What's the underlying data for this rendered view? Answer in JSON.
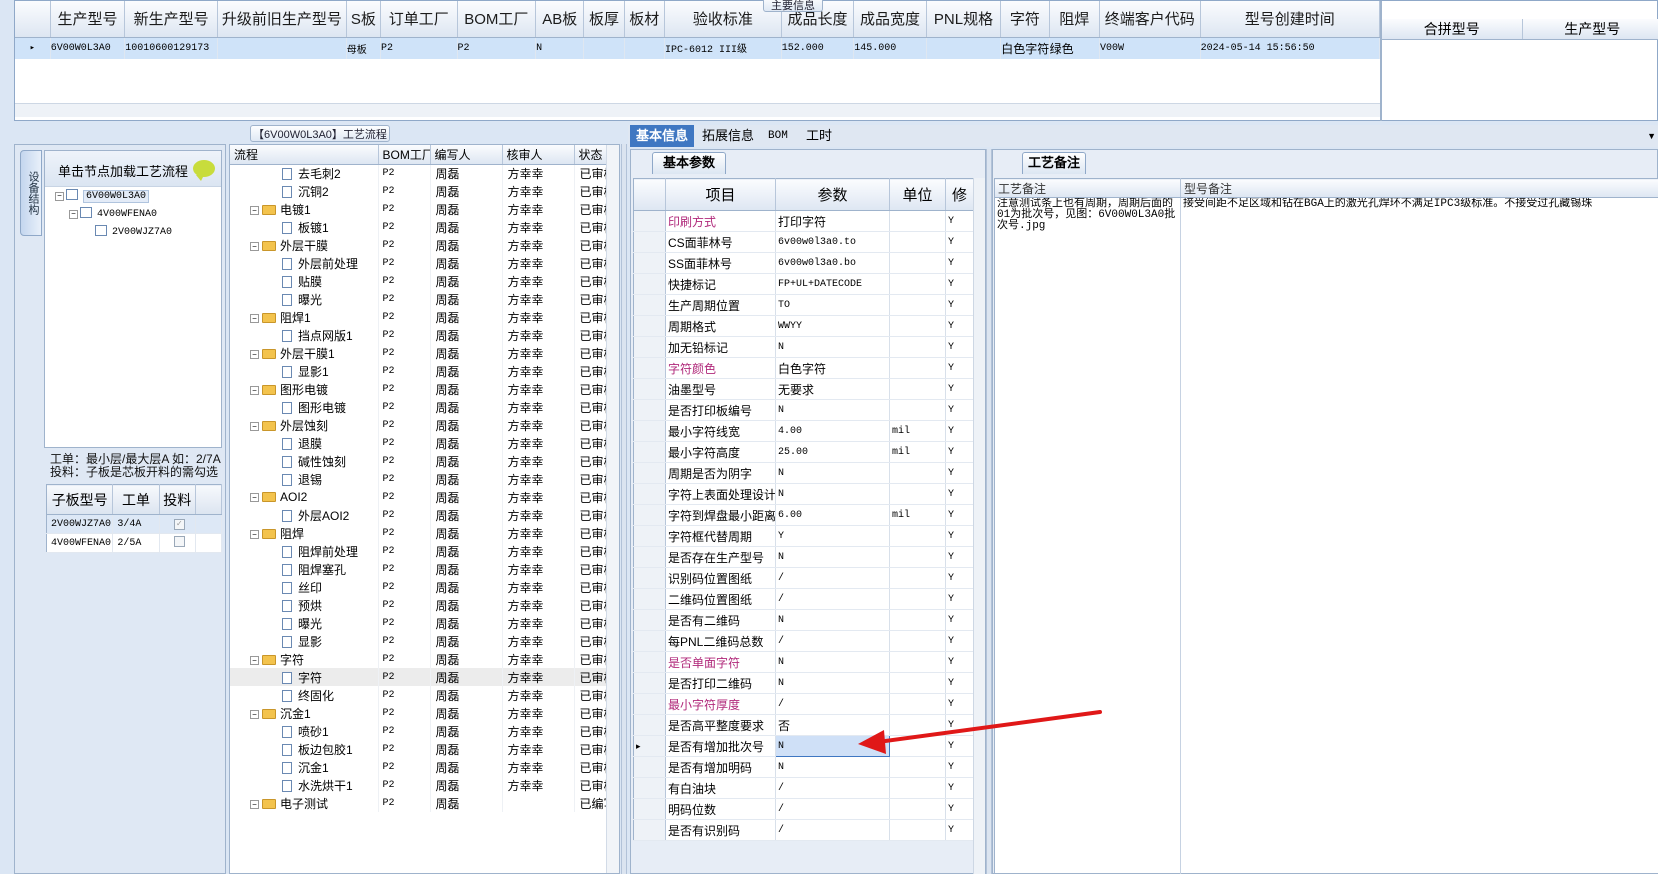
{
  "top": {
    "group_title": "主要信息",
    "columns": [
      "生产型号",
      "新生产型号",
      "升级前旧生产型号",
      "S板",
      "订单工厂",
      "BOM工厂",
      "AB板",
      "板厚",
      "板材",
      "验收标准",
      "成品长度",
      "成品宽度",
      "PNL规格",
      "字符",
      "阻焊",
      "终端客户代码",
      "型号创建时间"
    ],
    "row": [
      "6V00W0L3A0",
      "10010600129173",
      "",
      "母板",
      "P2",
      "P2",
      "N",
      "",
      "",
      "IPC-6012 III级",
      "152.000",
      "145.000",
      "",
      "白色字符",
      "绿色",
      "V00W",
      "2024-05-14 15:56:50"
    ],
    "right_columns": [
      "合拼型号",
      "生产型号"
    ]
  },
  "left": {
    "vertical_tab": "设备结构",
    "tree_header": "单击节点加载工艺流程",
    "tree": [
      "6V00W0L3A0",
      "4V00WFENA0",
      "2V00WJZ7A0"
    ],
    "note_line1": "工单：最小层/最大层A 如：2/7A",
    "note_line2": "投料：子板是芯板开料的需勾选",
    "sub_columns": [
      "子板型号",
      "工单",
      "投料"
    ],
    "sub_rows": [
      {
        "model": "2V00WJZ7A0",
        "order": "3/4A",
        "checked": true
      },
      {
        "model": "4V00WFENA0",
        "order": "2/5A",
        "checked": false
      }
    ]
  },
  "process": {
    "group_title": "【6V00W0L3A0】工艺流程",
    "columns": [
      "流程",
      "BOM工厂",
      "编写人",
      "核审人",
      "状态"
    ],
    "rows": [
      {
        "name": "去毛刺2",
        "folder": false,
        "bom": "P2",
        "writer": "周磊",
        "reviewer": "方幸幸",
        "status": "已审核"
      },
      {
        "name": "沉铜2",
        "folder": false,
        "bom": "P2",
        "writer": "周磊",
        "reviewer": "方幸幸",
        "status": "已审核"
      },
      {
        "name": "电镀1",
        "folder": true,
        "bom": "P2",
        "writer": "周磊",
        "reviewer": "方幸幸",
        "status": "已审核"
      },
      {
        "name": "板镀1",
        "folder": false,
        "bom": "P2",
        "writer": "周磊",
        "reviewer": "方幸幸",
        "status": "已审核"
      },
      {
        "name": "外层干膜",
        "folder": true,
        "bom": "P2",
        "writer": "周磊",
        "reviewer": "方幸幸",
        "status": "已审核"
      },
      {
        "name": "外层前处理",
        "folder": false,
        "bom": "P2",
        "writer": "周磊",
        "reviewer": "方幸幸",
        "status": "已审核"
      },
      {
        "name": "贴膜",
        "folder": false,
        "bom": "P2",
        "writer": "周磊",
        "reviewer": "方幸幸",
        "status": "已审核"
      },
      {
        "name": "曝光",
        "folder": false,
        "bom": "P2",
        "writer": "周磊",
        "reviewer": "方幸幸",
        "status": "已审核"
      },
      {
        "name": "阻焊1",
        "folder": true,
        "bom": "P2",
        "writer": "周磊",
        "reviewer": "方幸幸",
        "status": "已审核"
      },
      {
        "name": "挡点网版1",
        "folder": false,
        "bom": "P2",
        "writer": "周磊",
        "reviewer": "方幸幸",
        "status": "已审核"
      },
      {
        "name": "外层干膜1",
        "folder": true,
        "bom": "P2",
        "writer": "周磊",
        "reviewer": "方幸幸",
        "status": "已审核"
      },
      {
        "name": "显影1",
        "folder": false,
        "bom": "P2",
        "writer": "周磊",
        "reviewer": "方幸幸",
        "status": "已审核"
      },
      {
        "name": "图形电镀",
        "folder": true,
        "bom": "P2",
        "writer": "周磊",
        "reviewer": "方幸幸",
        "status": "已审核"
      },
      {
        "name": "图形电镀",
        "folder": false,
        "bom": "P2",
        "writer": "周磊",
        "reviewer": "方幸幸",
        "status": "已审核"
      },
      {
        "name": "外层蚀刻",
        "folder": true,
        "bom": "P2",
        "writer": "周磊",
        "reviewer": "方幸幸",
        "status": "已审核"
      },
      {
        "name": "退膜",
        "folder": false,
        "bom": "P2",
        "writer": "周磊",
        "reviewer": "方幸幸",
        "status": "已审核"
      },
      {
        "name": "碱性蚀刻",
        "folder": false,
        "bom": "P2",
        "writer": "周磊",
        "reviewer": "方幸幸",
        "status": "已审核"
      },
      {
        "name": "退锡",
        "folder": false,
        "bom": "P2",
        "writer": "周磊",
        "reviewer": "方幸幸",
        "status": "已审核"
      },
      {
        "name": "AOI2",
        "folder": true,
        "bom": "P2",
        "writer": "周磊",
        "reviewer": "方幸幸",
        "status": "已审核"
      },
      {
        "name": "外层AOI2",
        "folder": false,
        "bom": "P2",
        "writer": "周磊",
        "reviewer": "方幸幸",
        "status": "已审核"
      },
      {
        "name": "阻焊",
        "folder": true,
        "bom": "P2",
        "writer": "周磊",
        "reviewer": "方幸幸",
        "status": "已审核"
      },
      {
        "name": "阻焊前处理",
        "folder": false,
        "bom": "P2",
        "writer": "周磊",
        "reviewer": "方幸幸",
        "status": "已审核"
      },
      {
        "name": "阻焊塞孔",
        "folder": false,
        "bom": "P2",
        "writer": "周磊",
        "reviewer": "方幸幸",
        "status": "已审核"
      },
      {
        "name": "丝印",
        "folder": false,
        "bom": "P2",
        "writer": "周磊",
        "reviewer": "方幸幸",
        "status": "已审核"
      },
      {
        "name": "预烘",
        "folder": false,
        "bom": "P2",
        "writer": "周磊",
        "reviewer": "方幸幸",
        "status": "已审核"
      },
      {
        "name": "曝光",
        "folder": false,
        "bom": "P2",
        "writer": "周磊",
        "reviewer": "方幸幸",
        "status": "已审核"
      },
      {
        "name": "显影",
        "folder": false,
        "bom": "P2",
        "writer": "周磊",
        "reviewer": "方幸幸",
        "status": "已审核"
      },
      {
        "name": "字符",
        "folder": true,
        "bom": "P2",
        "writer": "周磊",
        "reviewer": "方幸幸",
        "status": "已审核"
      },
      {
        "name": "字符",
        "folder": false,
        "bom": "P2",
        "writer": "周磊",
        "reviewer": "方幸幸",
        "status": "已审核",
        "selected": true
      },
      {
        "name": "终固化",
        "folder": false,
        "bom": "P2",
        "writer": "周磊",
        "reviewer": "方幸幸",
        "status": "已审核"
      },
      {
        "name": "沉金1",
        "folder": true,
        "bom": "P2",
        "writer": "周磊",
        "reviewer": "方幸幸",
        "status": "已审核"
      },
      {
        "name": "喷砂1",
        "folder": false,
        "bom": "P2",
        "writer": "周磊",
        "reviewer": "方幸幸",
        "status": "已审核"
      },
      {
        "name": "板边包胶1",
        "folder": false,
        "bom": "P2",
        "writer": "周磊",
        "reviewer": "方幸幸",
        "status": "已审核"
      },
      {
        "name": "沉金1",
        "folder": false,
        "bom": "P2",
        "writer": "周磊",
        "reviewer": "方幸幸",
        "status": "已审核"
      },
      {
        "name": "水洗烘干1",
        "folder": false,
        "bom": "P2",
        "writer": "周磊",
        "reviewer": "方幸幸",
        "status": "已审核"
      },
      {
        "name": "电子测试",
        "folder": true,
        "bom": "P2",
        "writer": "周磊",
        "reviewer": "",
        "status": "已编写"
      }
    ]
  },
  "tabs": [
    "基本信息",
    "拓展信息",
    "BOM",
    "工时"
  ],
  "basic": {
    "subtab": "基本参数",
    "columns": [
      "项目",
      "参数",
      "单位",
      "修"
    ],
    "rows": [
      {
        "item": "印刷方式",
        "value": "打印字符",
        "unit": "",
        "edit": "Y",
        "hl": true
      },
      {
        "item": "CS面菲林号",
        "value": "6v00w0l3a0.to",
        "unit": "",
        "edit": "Y"
      },
      {
        "item": "SS面菲林号",
        "value": "6v00w0l3a0.bo",
        "unit": "",
        "edit": "Y"
      },
      {
        "item": "快捷标记",
        "value": "FP+UL+DATECODE",
        "unit": "",
        "edit": "Y"
      },
      {
        "item": "生产周期位置",
        "value": "TO",
        "unit": "",
        "edit": "Y"
      },
      {
        "item": "周期格式",
        "value": "WWYY",
        "unit": "",
        "edit": "Y"
      },
      {
        "item": "加无铅标记",
        "value": "N",
        "unit": "",
        "edit": "Y"
      },
      {
        "item": "字符颜色",
        "value": "白色字符",
        "unit": "",
        "edit": "Y",
        "hl": true
      },
      {
        "item": "油墨型号",
        "value": "无要求",
        "unit": "",
        "edit": "Y"
      },
      {
        "item": "是否打印板编号",
        "value": "N",
        "unit": "",
        "edit": "Y"
      },
      {
        "item": "最小字符线宽",
        "value": "4.00",
        "unit": "mil",
        "edit": "Y"
      },
      {
        "item": "最小字符高度",
        "value": "25.00",
        "unit": "mil",
        "edit": "Y"
      },
      {
        "item": "周期是否为阴字",
        "value": "N",
        "unit": "",
        "edit": "Y"
      },
      {
        "item": "字符上表面处理设计",
        "value": "N",
        "unit": "",
        "edit": "Y"
      },
      {
        "item": "字符到焊盘最小距离",
        "value": "6.00",
        "unit": "mil",
        "edit": "Y"
      },
      {
        "item": "字符框代替周期",
        "value": "Y",
        "unit": "",
        "edit": "Y"
      },
      {
        "item": "是否存在生产型号",
        "value": "N",
        "unit": "",
        "edit": "Y"
      },
      {
        "item": "识别码位置图纸",
        "value": "/",
        "unit": "",
        "edit": "Y"
      },
      {
        "item": "二维码位置图纸",
        "value": "/",
        "unit": "",
        "edit": "Y"
      },
      {
        "item": "是否有二维码",
        "value": "N",
        "unit": "",
        "edit": "Y"
      },
      {
        "item": "每PNL二维码总数",
        "value": "/",
        "unit": "",
        "edit": "Y"
      },
      {
        "item": "是否单面字符",
        "value": "N",
        "unit": "",
        "edit": "Y",
        "hl": true
      },
      {
        "item": "是否打印二维码",
        "value": "N",
        "unit": "",
        "edit": "Y"
      },
      {
        "item": "最小字符厚度",
        "value": "/",
        "unit": "",
        "edit": "Y",
        "hl": true
      },
      {
        "item": "是否高平整度要求",
        "value": "否",
        "unit": "",
        "edit": "Y"
      },
      {
        "item": "是否有增加批次号",
        "value": "N",
        "unit": "",
        "edit": "Y",
        "current": true
      },
      {
        "item": "是否有增加明码",
        "value": "N",
        "unit": "",
        "edit": "Y"
      },
      {
        "item": "有白油块",
        "value": "/",
        "unit": "",
        "edit": "Y"
      },
      {
        "item": "明码位数",
        "value": "/",
        "unit": "",
        "edit": "Y"
      },
      {
        "item": "是否有识别码",
        "value": "/",
        "unit": "",
        "edit": "Y"
      }
    ]
  },
  "remarks": {
    "subtab": "工艺备注",
    "col1": "工艺备注",
    "col2": "型号备注",
    "text1": "注意测试条上也有周期，周期后面的01为批次号，见图：6V00W0L3A0批次号.jpg",
    "text2": "接受间距不足区域和钻在BGA上的激光孔焊环不满足IPC3级标准。不接受过孔藏锡珠"
  },
  "colors": {
    "accent": "#3f77c2",
    "highlight_text": "#b0287a",
    "arrow": "#e01818"
  }
}
